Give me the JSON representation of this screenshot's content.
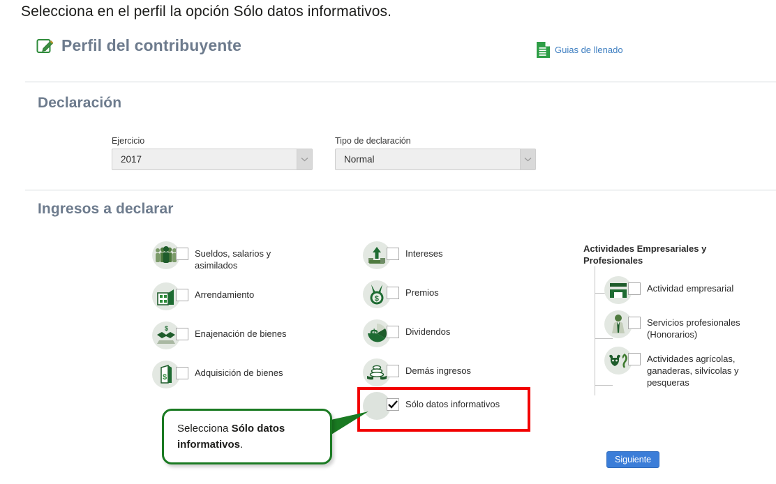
{
  "instruction": "Selecciona en el perfil la opción Sólo datos informativos.",
  "header": {
    "title": "Perfil del contribuyente",
    "edit_icon": "edit-pencil-icon",
    "guide_link": "Guias de llenado",
    "guide_icon": "document-icon"
  },
  "sections": {
    "declaracion_title": "Declaración",
    "ingresos_title": "Ingresos a declarar"
  },
  "declaracion": {
    "ejercicio": {
      "label": "Ejercicio",
      "value": "2017"
    },
    "tipo_declaracion": {
      "label": "Tipo de declaración",
      "value": "Normal"
    }
  },
  "ingresos": {
    "column1": [
      {
        "label": "Sueldos, salarios y asimilados",
        "icon": "people-group-icon",
        "checked": false
      },
      {
        "label": "Arrendamiento",
        "icon": "building-icon",
        "checked": false
      },
      {
        "label": "Enajenación de bienes",
        "icon": "handshake-money-icon",
        "checked": false
      },
      {
        "label": "Adquisición de bienes",
        "icon": "money-bag-icon",
        "checked": false
      }
    ],
    "column2": [
      {
        "label": "Intereses",
        "icon": "money-growth-icon",
        "checked": false
      },
      {
        "label": "Premios",
        "icon": "prize-medal-icon",
        "checked": false
      },
      {
        "label": "Dividendos",
        "icon": "pie-chart-dollar-icon",
        "checked": false
      },
      {
        "label": "Demás ingresos",
        "icon": "coins-stack-icon",
        "checked": false
      }
    ],
    "solo_datos": {
      "label": "Sólo datos informativos",
      "icon": "blank-circle-icon",
      "checked": true,
      "highlighted": true
    },
    "column3": {
      "title": "Actividades Empresariales y Profesionales",
      "items": [
        {
          "label": "Actividad empresarial",
          "icon": "store-icon",
          "checked": false
        },
        {
          "label": "Servicios profesionales (Honorarios)",
          "icon": "professional-person-icon",
          "checked": false
        },
        {
          "label": "Actividades agrícolas, ganaderas, silvícolas y pesqueras",
          "icon": "bull-plant-icon",
          "checked": false
        }
      ]
    }
  },
  "callout": {
    "text_prefix": "Selecciona ",
    "text_bold": "Sólo datos informativos",
    "text_suffix": "."
  },
  "footer": {
    "next_button": "Siguiente"
  },
  "colors": {
    "heading": "#6d7b8d",
    "link": "#3f7fc1",
    "highlight_red": "#f20000",
    "callout_green": "#1a7a22",
    "button_blue": "#3b7dd8",
    "icon_green": "#1e6b32"
  }
}
